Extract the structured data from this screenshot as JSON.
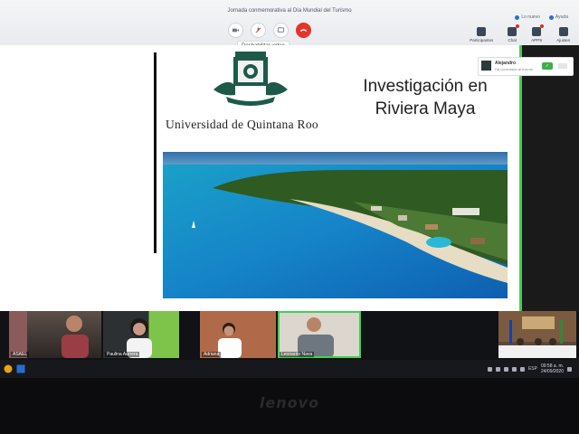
{
  "window": {
    "title": "Jornada conmemorativa al Día Mundial del Turismo"
  },
  "topbar": {
    "meta": [
      {
        "icon": "network-icon",
        "label": "Lo nuevo"
      },
      {
        "icon": "help-icon",
        "label": "Ayuda"
      }
    ],
    "right_buttons": [
      {
        "icon": "participants-icon",
        "label": "Participantes"
      },
      {
        "icon": "chat-icon",
        "label": "Chat"
      },
      {
        "icon": "apps-icon",
        "label": "APPS"
      },
      {
        "icon": "settings-icon",
        "label": "Ajustes"
      }
    ]
  },
  "controls": {
    "buttons": [
      {
        "icon": "video-icon",
        "label": "video"
      },
      {
        "icon": "mic-off-icon",
        "label": "mic"
      },
      {
        "icon": "share-screen-icon",
        "label": "compartir"
      },
      {
        "icon": "end-call-icon",
        "label": "colgar"
      }
    ],
    "tooltip": "Deshabilitar video"
  },
  "slide": {
    "university": "Universidad de Quintana Roo",
    "title_line1": "Investigación en",
    "title_line2": "Riviera Maya"
  },
  "notification": {
    "name": "Alejandro",
    "subtitle": "Ha conectado al evento"
  },
  "participants": [
    {
      "name": "ASAEL",
      "speaking": false
    },
    {
      "name": "Paulina Aurrera",
      "speaking": false
    },
    {
      "name": "Adriana",
      "speaking": false
    },
    {
      "name": "Leonardo Nava",
      "speaking": true
    },
    {
      "name": "",
      "speaking": false
    }
  ],
  "taskbar": {
    "lang": "ESP",
    "time": "09:58 a. m.",
    "date": "24/09/2020"
  },
  "device": {
    "brand": "lenovo"
  },
  "colors": {
    "speaking_border": "#3fd14f",
    "end_call": "#e3342f",
    "accent": "#2a6fd6"
  }
}
